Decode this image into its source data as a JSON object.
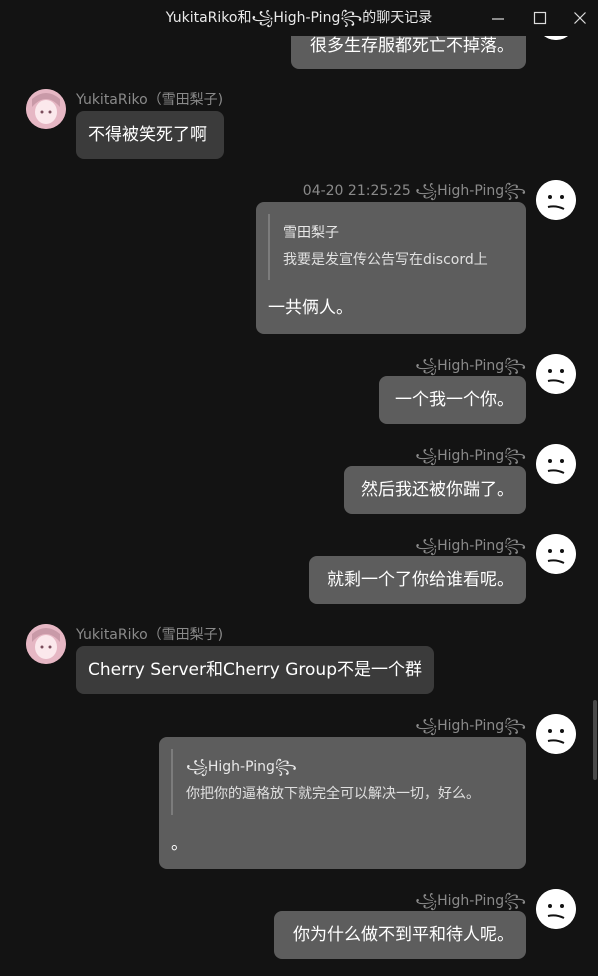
{
  "window": {
    "title": "YukitaRiko和꧁High-Ping꧂的聊天记录",
    "minimize_glyph": "—",
    "maximize_glyph": "☐",
    "close_glyph": "✕"
  },
  "messages": [
    {
      "side": "right",
      "sender": "",
      "text": "很多生存服都死亡不掉落。"
    },
    {
      "side": "left",
      "sender": "YukitaRiko（雪田梨子)",
      "text": "不得被笑死了啊"
    },
    {
      "side": "right",
      "timestamp": "04-20 21:25:25",
      "sender": "꧁High-Ping꧂",
      "quote": {
        "author": "雪田梨子",
        "text": "我要是发宣传公告写在discord上"
      },
      "text": "一共俩人。"
    },
    {
      "side": "right",
      "sender": "꧁High-Ping꧂",
      "text": "一个我一个你。"
    },
    {
      "side": "right",
      "sender": "꧁High-Ping꧂",
      "text": "然后我还被你踹了。"
    },
    {
      "side": "right",
      "sender": "꧁High-Ping꧂",
      "text": "就剩一个了你给谁看呢。"
    },
    {
      "side": "left",
      "sender": "YukitaRiko（雪田梨子)",
      "text": "Cherry Server和Cherry Group不是一个群"
    },
    {
      "side": "right",
      "sender": "꧁High-Ping꧂",
      "quote": {
        "author": "꧁High-Ping꧂",
        "text": "你把你的逼格放下就完全可以解决一切，好么。"
      },
      "text": "。"
    },
    {
      "side": "right",
      "sender": "꧁High-Ping꧂",
      "text": "你为什么做不到平和待人呢。"
    }
  ],
  "colors": {
    "background": "#131313",
    "bubble_self": "#5d5d5d",
    "bubble_other": "#3b3b3b",
    "name_text": "#8a8a8a"
  },
  "icons": {
    "riko_avatar": "anime-girl-avatar",
    "highping_avatar": "neutral-face-avatar"
  }
}
